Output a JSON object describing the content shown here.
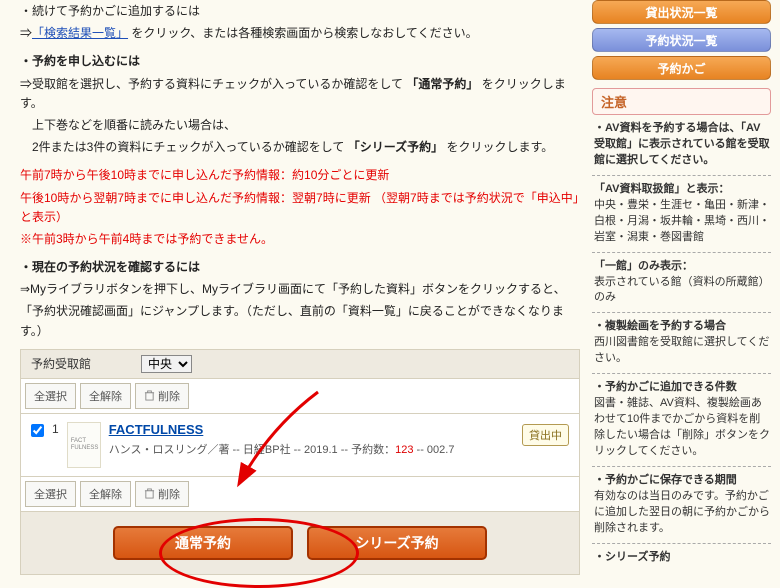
{
  "main": {
    "line1_prefix": "・続けて予約かごに追加するには",
    "line1_arrow": "⇒",
    "line1_link": "「検索結果一覧」",
    "line1_suffix": " をクリック、または各種検索画面から検索しなおしてください。",
    "line2_head": "・予約を申し込むには",
    "line2_a": "⇒受取館を選択し、予約する資料にチェックが入っているか確認をして ",
    "line2_a_bold": "「通常予約」",
    "line2_a_tail": " をクリックします。",
    "line2_b": "　上下巻などを順番に読みたい場合は、",
    "line2_c": "　2件または3件の資料にチェックが入っているか確認をして ",
    "line2_c_bold": "「シリーズ予約」",
    "line2_c_tail": " をクリックします。",
    "red1": "午前7時から午後10時までに申し込んだ予約情報：約10分ごとに更新",
    "red2": "午後10時から翌朝7時までに申し込んだ予約情報：翌朝7時に更新 （翌朝7時までは予約状況で「申込中」と表示）",
    "red3": "※午前3時から午前4時までは予約できません。",
    "line3_head": "・現在の予約状況を確認するには",
    "line3_a": "⇒Myライブラリボタンを押下し、Myライブラリ画面にて「予約した資料」ボタンをクリックすると、",
    "line3_b": "「予約状況確認画面」にジャンプします。（ただし、直前の「資料一覧」に戻ることができなくなります。）",
    "pickup_label": "予約受取館",
    "pickup_value": "中央",
    "select_all": "全選択",
    "deselect_all": "全解除",
    "delete": "削除",
    "item": {
      "num": "1",
      "thumb_text": "FACT\nFULNESS",
      "title": "FACTFULNESS",
      "meta_a": "ハンス・ロスリング／著 -- 日経BP社 -- 2019.1 -- 予約数：",
      "meta_num": "123",
      "meta_b": " -- 002.7",
      "badge": "貸出中"
    },
    "btn_normal": "通常予約",
    "btn_series": "シリーズ予約"
  },
  "side": {
    "btn_loan": "貸出状況一覧",
    "btn_reserve": "予約状況一覧",
    "btn_cart": "予約かご",
    "caution": "注意",
    "c1": "・AV資料を予約する場合は、「AV受取館」に表示されている館を受取館に選択してください。",
    "c2a": "「AV資料取扱館」と表示：",
    "c2b": "中央・豊栄・生涯セ・亀田・新津・白根・月潟・坂井輪・黒埼・西川・岩室・潟東・巻図書館",
    "c3a": "「一館」のみ表示：",
    "c3b": "表示されている館（資料の所蔵館）のみ",
    "c4a": "・複製絵画を予約する場合",
    "c4b": "西川図書館を受取館に選択してください。",
    "c5a": "・予約かごに追加できる件数",
    "c5b": "図書・雑誌、AV資料、複製絵画あわせて10件までかごから資料を削除したい場合は「削除」ボタンをクリックしてください。",
    "c6a": "・予約かごに保存できる期間",
    "c6b": "有効なのは当日のみです。予約かごに追加した翌日の朝に予約かごから削除されます。",
    "c7a": "・シリーズ予約"
  }
}
